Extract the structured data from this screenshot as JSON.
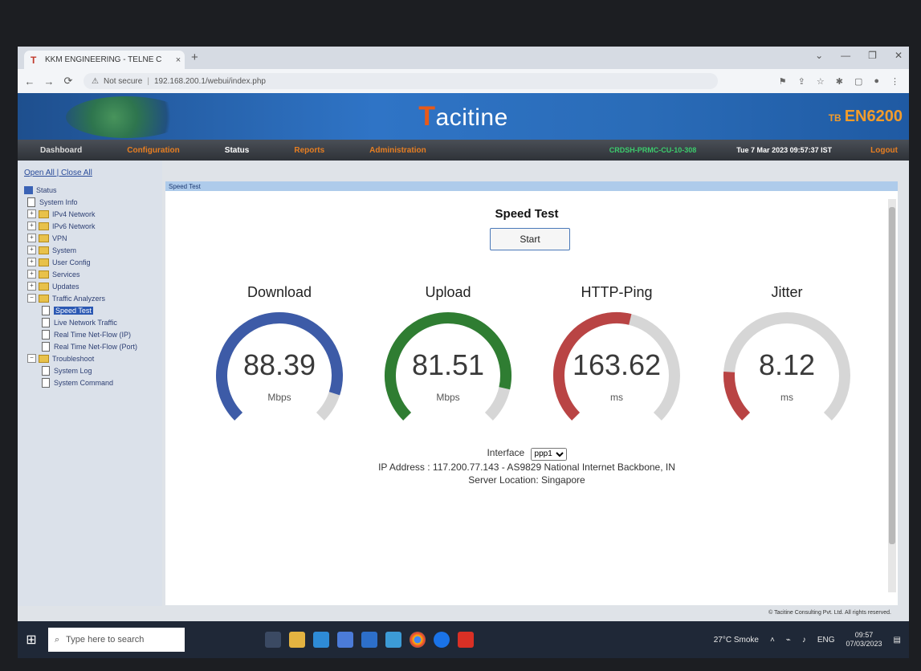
{
  "browser": {
    "tab_title": "KKM ENGINEERING - TELNE C",
    "tab_close": "×",
    "new_tab": "+",
    "url_warning": "Not secure",
    "url": "192.168.200.1/webui/index.php",
    "window_controls": [
      "⌄",
      "—",
      "❐",
      "✕"
    ]
  },
  "header": {
    "brand_rest": "acitine",
    "brand_t": "T",
    "model_prefix": "TB",
    "model": "EN6200"
  },
  "menu": {
    "items": [
      "Dashboard",
      "Configuration",
      "Status",
      "Reports",
      "Administration"
    ],
    "active": "Status",
    "registration": "CRDSH-PRMC-CU-10-308",
    "datetime": "Tue 7 Mar 2023 09:57:37 IST",
    "logout": "Logout"
  },
  "sidebar": {
    "open_close": "Open All | Close All",
    "tree": [
      {
        "label": "Status",
        "level": 0,
        "type": "computer"
      },
      {
        "label": "System Info",
        "level": 1,
        "type": "doc"
      },
      {
        "label": "IPv4 Network",
        "level": 1,
        "type": "folder"
      },
      {
        "label": "IPv6 Network",
        "level": 1,
        "type": "folder"
      },
      {
        "label": "VPN",
        "level": 1,
        "type": "folder"
      },
      {
        "label": "System",
        "level": 1,
        "type": "folder"
      },
      {
        "label": "User Config",
        "level": 1,
        "type": "folder"
      },
      {
        "label": "Services",
        "level": 1,
        "type": "folder"
      },
      {
        "label": "Updates",
        "level": 1,
        "type": "folder"
      },
      {
        "label": "Traffic Analyzers",
        "level": 1,
        "type": "folder-open"
      },
      {
        "label": "Speed Test",
        "level": 2,
        "type": "doc",
        "selected": true
      },
      {
        "label": "Live Network Traffic",
        "level": 2,
        "type": "doc"
      },
      {
        "label": "Real Time Net-Flow (IP)",
        "level": 2,
        "type": "doc"
      },
      {
        "label": "Real Time Net-Flow (Port)",
        "level": 2,
        "type": "doc"
      },
      {
        "label": "Troubleshoot",
        "level": 1,
        "type": "folder-open"
      },
      {
        "label": "System Log",
        "level": 2,
        "type": "doc"
      },
      {
        "label": "System Command",
        "level": 2,
        "type": "doc"
      }
    ]
  },
  "content": {
    "breadcrumb": "Speed Test",
    "title": "Speed Test",
    "start_label": "Start",
    "gauges": [
      {
        "label": "Download",
        "value": "88.39",
        "unit": "Mbps",
        "fraction": 0.9,
        "color": "#3d5ba7"
      },
      {
        "label": "Upload",
        "value": "81.51",
        "unit": "Mbps",
        "fraction": 0.88,
        "color": "#2f7d32"
      },
      {
        "label": "HTTP-Ping",
        "value": "163.62",
        "unit": "ms",
        "fraction": 0.55,
        "color": "#b94444"
      },
      {
        "label": "Jitter",
        "value": "8.12",
        "unit": "ms",
        "fraction": 0.18,
        "color": "#b94444"
      }
    ],
    "interface_label": "Interface",
    "interface_value": "ppp1",
    "ip_line": "IP Address : 117.200.77.143 - AS9829 National Internet Backbone, IN",
    "server_line": "Server Location: Singapore",
    "footer": "© Tacitine Consulting Pvt. Ltd. All rights reserved."
  },
  "taskbar": {
    "search_placeholder": "Type here to search",
    "weather": "27°C Smoke",
    "lang": "ENG",
    "time": "09:57",
    "date": "07/03/2023"
  },
  "colors": {
    "track": "#d6d6d6",
    "brand_orange": "#e85a18",
    "menu_orange": "#e67e22",
    "selected_node": "#2b58b3"
  }
}
